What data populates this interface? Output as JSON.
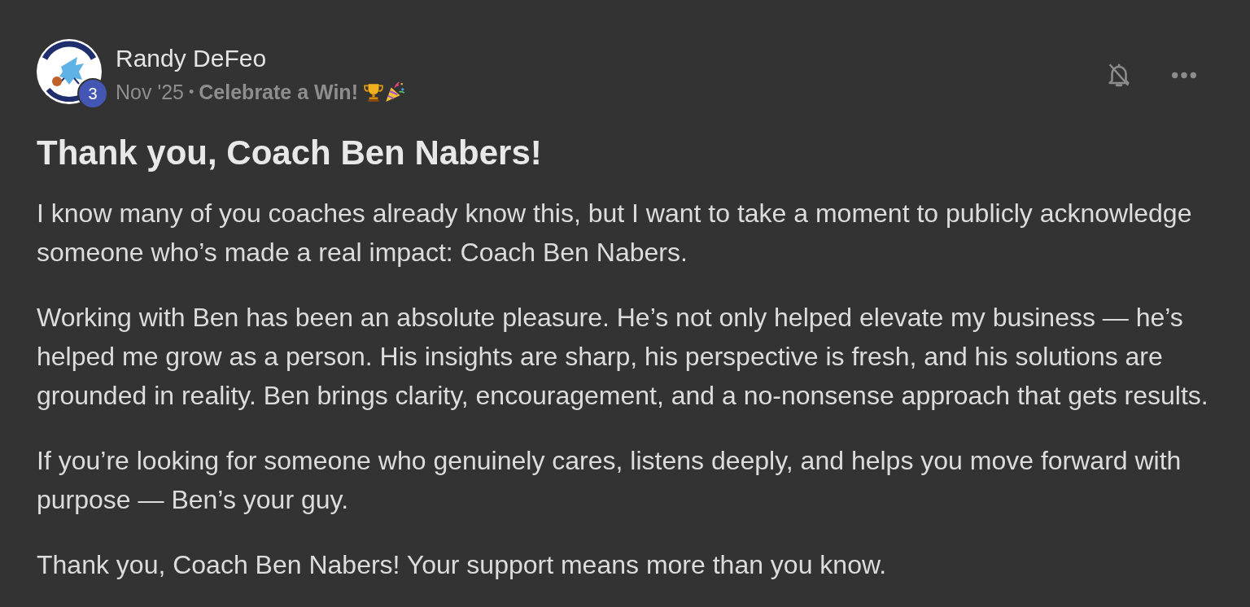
{
  "post": {
    "author": {
      "name": "Randy DeFeo",
      "badge": "3"
    },
    "meta": {
      "date": "Nov '25",
      "separator": "•",
      "category": "Celebrate a Win!"
    },
    "notifications": {
      "muted": true
    },
    "title": "Thank you, Coach Ben Nabers!",
    "paragraphs": [
      "I know many of you coaches already know this, but I want to take a moment to publicly acknowledge someone who’s made a real impact: Coach Ben Nabers.",
      "Working with Ben has been an absolute pleasure. He’s not only helped elevate my business — he’s helped me grow as a person. His insights are sharp, his perspective is fresh, and his solutions are grounded in reality. Ben brings clarity, encouragement, and a no-nonsense approach that gets results.",
      "If you’re looking for someone who genuinely cares, listens deeply, and helps you move forward with purpose — Ben’s your guy.",
      "Thank you, Coach Ben Nabers! Your support means more than you know."
    ]
  }
}
